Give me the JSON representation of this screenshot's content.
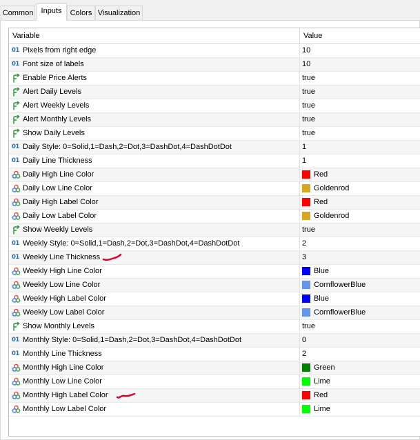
{
  "tabs": [
    {
      "label": "Common"
    },
    {
      "label": "Inputs"
    },
    {
      "label": "Colors"
    },
    {
      "label": "Visualization"
    }
  ],
  "table": {
    "header_variable": "Variable",
    "header_value": "Value"
  },
  "rows": [
    {
      "type": "int",
      "name": "Pixels from right edge",
      "value": "10"
    },
    {
      "type": "int",
      "name": "Font size of labels",
      "value": "10"
    },
    {
      "type": "bool",
      "name": "Enable Price Alerts",
      "value": "true"
    },
    {
      "type": "bool",
      "name": "Alert Daily Levels",
      "value": "true"
    },
    {
      "type": "bool",
      "name": "Alert Weekly Levels",
      "value": "true"
    },
    {
      "type": "bool",
      "name": "Alert Monthly Levels",
      "value": "true"
    },
    {
      "type": "bool",
      "name": "Show Daily Levels",
      "value": "true"
    },
    {
      "type": "int",
      "name": "Daily Style: 0=Solid,1=Dash,2=Dot,3=DashDot,4=DashDotDot",
      "value": "1"
    },
    {
      "type": "int",
      "name": "Daily Line Thickness",
      "value": "1"
    },
    {
      "type": "color",
      "name": "Daily High Line Color",
      "value": "Red",
      "swatch": "#ff0000"
    },
    {
      "type": "color",
      "name": "Daily Low Line Color",
      "value": "Goldenrod",
      "swatch": "#daa520"
    },
    {
      "type": "color",
      "name": "Daily High Label Color",
      "value": "Red",
      "swatch": "#ff0000"
    },
    {
      "type": "color",
      "name": "Daily Low Label Color",
      "value": "Goldenrod",
      "swatch": "#daa520"
    },
    {
      "type": "bool",
      "name": "Show Weekly Levels",
      "value": "true"
    },
    {
      "type": "int",
      "name": "Weekly Style: 0=Solid,1=Dash,2=Dot,3=DashDot,4=DashDotDot",
      "value": "2"
    },
    {
      "type": "int",
      "name": "Weekly Line Thickness",
      "value": "3"
    },
    {
      "type": "color",
      "name": "Weekly High Line Color",
      "value": "Blue",
      "swatch": "#0000ff"
    },
    {
      "type": "color",
      "name": "Weekly Low Line Color",
      "value": "CornflowerBlue",
      "swatch": "#6495ed"
    },
    {
      "type": "color",
      "name": "Weekly High Label Color",
      "value": "Blue",
      "swatch": "#0000ff"
    },
    {
      "type": "color",
      "name": "Weekly Low Label Color",
      "value": "CornflowerBlue",
      "swatch": "#6495ed"
    },
    {
      "type": "bool",
      "name": "Show Monthly Levels",
      "value": "true"
    },
    {
      "type": "int",
      "name": "Monthly Style: 0=Solid,1=Dash,2=Dot,3=DashDot,4=DashDotDot",
      "value": "0"
    },
    {
      "type": "int",
      "name": "Monthly Line Thickness",
      "value": "2"
    },
    {
      "type": "color",
      "name": "Monthly High Line Color",
      "value": "Green",
      "swatch": "#008000"
    },
    {
      "type": "color",
      "name": "Monthly Low Line Color",
      "value": "Lime",
      "swatch": "#00ff00"
    },
    {
      "type": "color",
      "name": "Monthly High Label Color",
      "value": "Red",
      "swatch": "#ff0000"
    },
    {
      "type": "color",
      "name": "Monthly Low Label Color",
      "value": "Lime",
      "swatch": "#00ff00"
    }
  ],
  "icons": {
    "int": "int-type-icon",
    "bool": "bool-type-icon",
    "color": "color-type-icon"
  },
  "colors": {
    "int_icon": "#2a6db5",
    "bool_icon": "#2e9a3a",
    "annotation": "#e0002a"
  }
}
